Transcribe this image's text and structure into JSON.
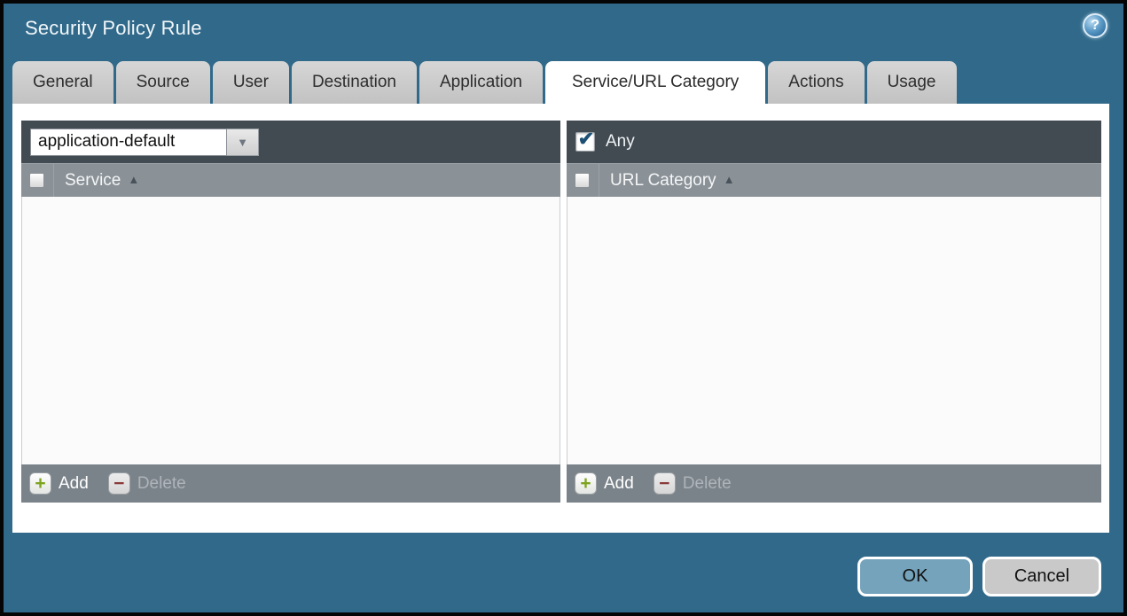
{
  "window": {
    "title": "Security Policy Rule"
  },
  "icons": {
    "help": "?",
    "add": "+",
    "delete": "−",
    "sort_asc": "▲",
    "dropdown_arrow": "▼",
    "check": "✔"
  },
  "colors": {
    "background_teal": "#30698a",
    "panel_toolbar_bg": "#424b52",
    "panel_header_bg": "#8a9197",
    "panel_footer_bg": "#7b838a",
    "tab_active_bg": "#ffffff",
    "tab_inactive_bg": "#c6c6c6",
    "add_icon_green": "#7ea41f",
    "delete_icon_red": "#8a3b3b",
    "ok_button_bg": "#74a3bb",
    "cancel_button_bg": "#c9c9c9",
    "checkmark_blue": "#1d4f74"
  },
  "tabs": [
    {
      "label": "General",
      "active": false
    },
    {
      "label": "Source",
      "active": false
    },
    {
      "label": "User",
      "active": false
    },
    {
      "label": "Destination",
      "active": false
    },
    {
      "label": "Application",
      "active": false
    },
    {
      "label": "Service/URL Category",
      "active": true
    },
    {
      "label": "Actions",
      "active": false
    },
    {
      "label": "Usage",
      "active": false
    }
  ],
  "service_panel": {
    "dropdown_value": "application-default",
    "column_header": "Service",
    "header_checkbox_checked": false,
    "rows": [],
    "add_label": "Add",
    "delete_label": "Delete",
    "delete_enabled": false
  },
  "url_category_panel": {
    "any_label": "Any",
    "any_checked": true,
    "column_header": "URL Category",
    "header_checkbox_checked": false,
    "rows": [],
    "add_label": "Add",
    "delete_label": "Delete",
    "delete_enabled": false
  },
  "dialog_buttons": {
    "ok_label": "OK",
    "cancel_label": "Cancel"
  }
}
